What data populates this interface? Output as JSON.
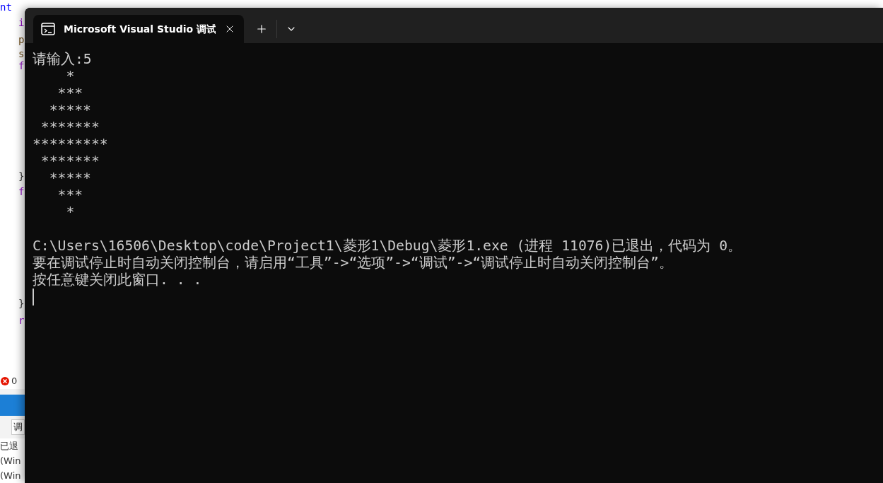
{
  "background_editor": {
    "code_lines": [
      "nt",
      "i",
      "p",
      "s",
      "f",
      "}",
      "f",
      "}",
      "r"
    ],
    "error_count": "0",
    "output_dropdown": "调",
    "output_lines": [
      "已退",
      "(Win",
      "(Win"
    ]
  },
  "window": {
    "tabs": [
      {
        "title": "Microsoft Visual Studio 调试",
        "selected": true
      }
    ]
  },
  "console": {
    "prompt": "请输入:5",
    "diamond": "    *\n   ***\n  *****\n *******\n*********\n *******\n  *****\n   ***\n    *",
    "exit_message": [
      "C:\\Users\\16506\\Desktop\\code\\Project1\\菱形1\\Debug\\菱形1.exe (进程 11076)已退出，代码为 0。",
      "要在调试停止时自动关闭控制台，请启用“工具”->“选项”->“调试”->“调试停止时自动关闭控制台”。",
      "按任意键关闭此窗口. . ."
    ]
  }
}
